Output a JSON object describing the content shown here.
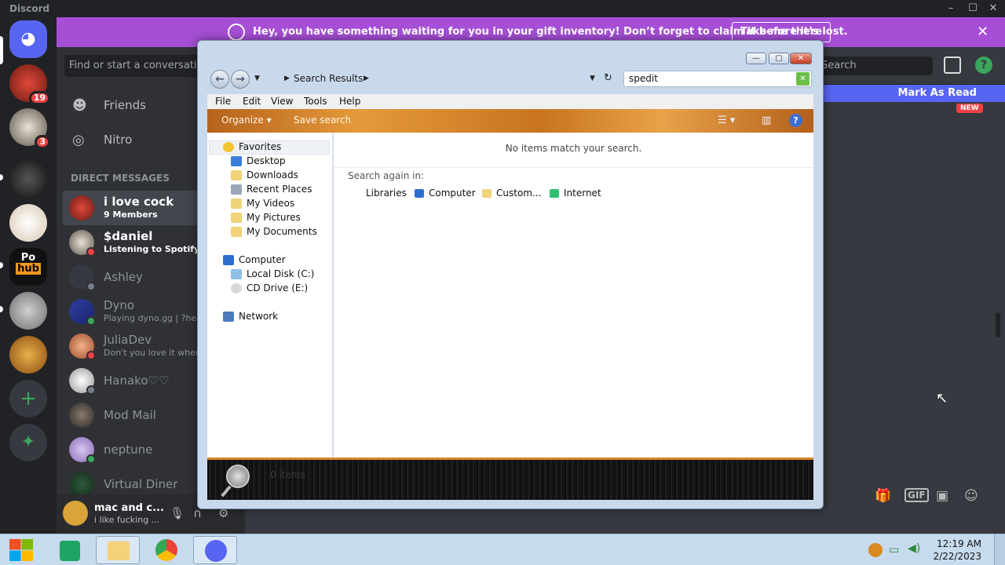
{
  "discord": {
    "app_title": "Discord",
    "notice": {
      "message": "Hey, you have something waiting for you in your gift inventory! Don’t forget to claim it before it’s lost.",
      "cta": "Take me there"
    },
    "dm_search_placeholder": "Find or start a conversation",
    "nav": {
      "friends": "Friends",
      "nitro": "Nitro"
    },
    "dm_header": "DIRECT MESSAGES",
    "guild_badges": [
      "19",
      "3"
    ],
    "guild_text": {
      "ph_top": "Po",
      "ph_bottom": "hub"
    },
    "dms": [
      {
        "name": "i love cock",
        "sub": "9 Members"
      },
      {
        "name": "$daniel",
        "sub": "Listening to Spotify"
      },
      {
        "name": "Ashley",
        "sub": ""
      },
      {
        "name": "Dyno",
        "sub": "Playing dyno.gg | ?help"
      },
      {
        "name": "JuliaDev",
        "sub": "Don't you love it when y"
      },
      {
        "name": "Hanako♡♡",
        "sub": ""
      },
      {
        "name": "Mod Mail",
        "sub": ""
      },
      {
        "name": "neptune",
        "sub": ""
      },
      {
        "name": "Virtual Diner",
        "sub": ""
      }
    ],
    "user": {
      "name": "mac and c...",
      "status": "i like fucking ..."
    },
    "main_search": "Search",
    "mark_as_read": "Mark As Read",
    "new_tag": "NEW",
    "composer": {
      "gif": "GIF"
    }
  },
  "explorer": {
    "address": "Search Results",
    "search_value": "spedit",
    "menu": [
      "File",
      "Edit",
      "View",
      "Tools",
      "Help"
    ],
    "commands": {
      "organize": "Organize",
      "save_search": "Save search"
    },
    "favorites": "Favorites",
    "fav_items": [
      "Desktop",
      "Downloads",
      "Recent Places",
      "My Videos",
      "My Pictures",
      "My Documents"
    ],
    "computer": "Computer",
    "drives": [
      "Local Disk (C:)",
      "CD Drive (E:)"
    ],
    "network": "Network",
    "no_items": "No items match your search.",
    "search_again": "Search again in:",
    "search_again_items": [
      "Libraries",
      "Computer",
      "Custom...",
      "Internet"
    ],
    "item_count": "0 items"
  },
  "taskbar": {
    "time": "12:19 AM",
    "date": "2/22/2023"
  }
}
